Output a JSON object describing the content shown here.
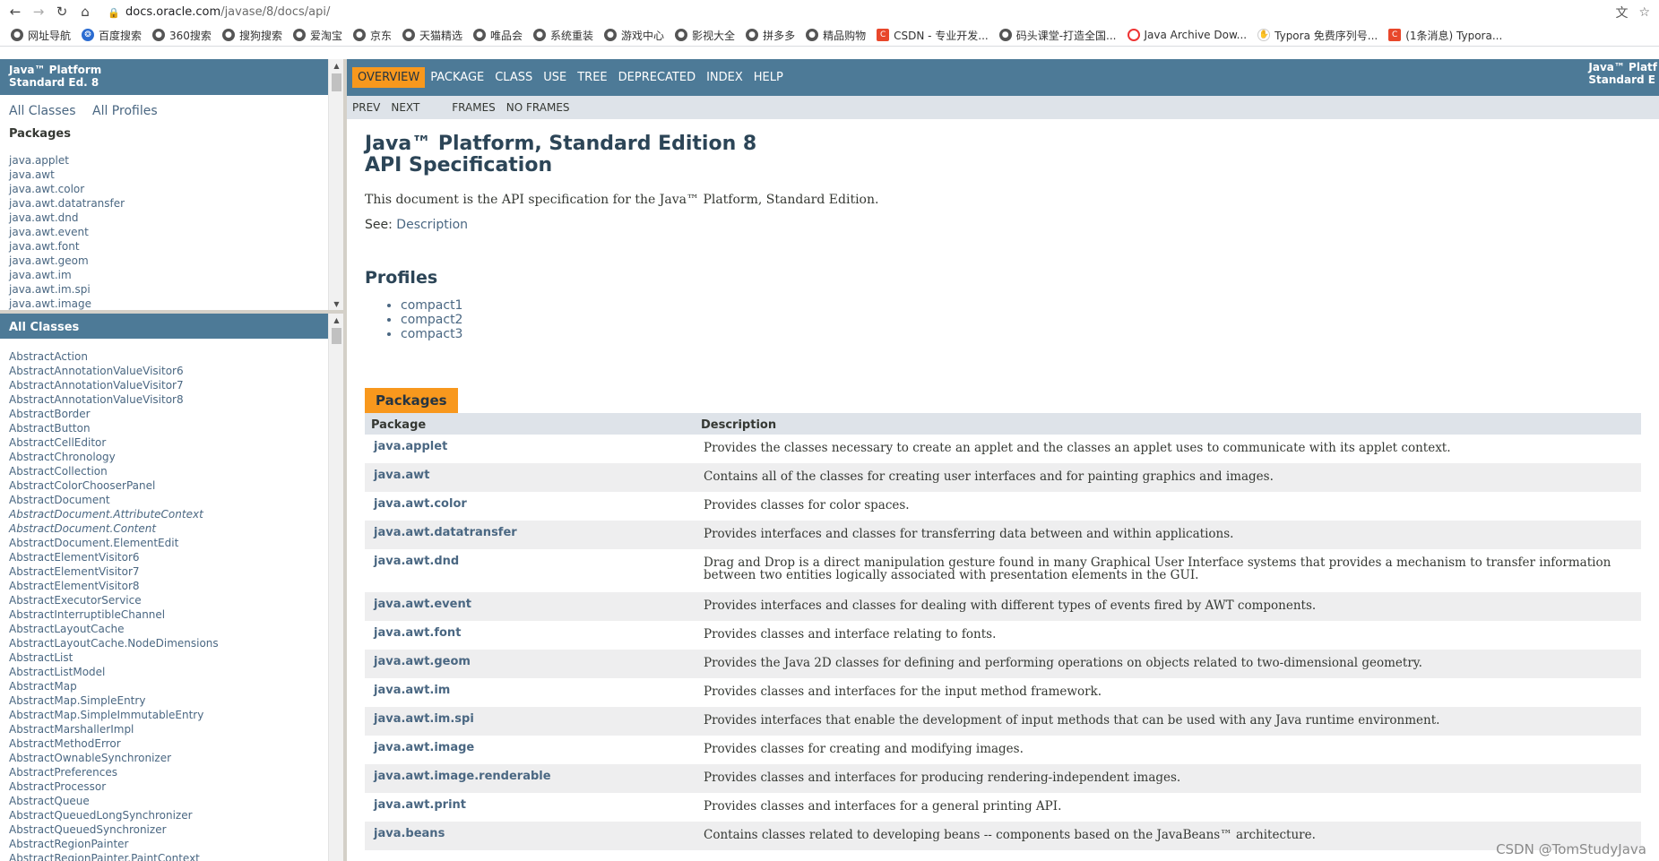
{
  "browser": {
    "url_host": "docs.oracle.com",
    "url_path": "/javase/8/docs/api/",
    "bookmarks": [
      {
        "label": "网址导航",
        "icon": "globe-icon"
      },
      {
        "label": "百度搜索",
        "icon": "baidu-icon"
      },
      {
        "label": "360搜索",
        "icon": "globe-icon"
      },
      {
        "label": "搜狗搜索",
        "icon": "globe-icon"
      },
      {
        "label": "爱淘宝",
        "icon": "globe-icon"
      },
      {
        "label": "京东",
        "icon": "globe-icon"
      },
      {
        "label": "天猫精选",
        "icon": "globe-icon"
      },
      {
        "label": "唯品会",
        "icon": "globe-icon"
      },
      {
        "label": "系统重装",
        "icon": "globe-icon"
      },
      {
        "label": "游戏中心",
        "icon": "globe-icon"
      },
      {
        "label": "影视大全",
        "icon": "globe-icon"
      },
      {
        "label": "拼多多",
        "icon": "globe-icon"
      },
      {
        "label": "精品购物",
        "icon": "globe-icon"
      },
      {
        "label": "CSDN - 专业开发...",
        "icon": "csdn-icon"
      },
      {
        "label": "码头课堂-打造全国...",
        "icon": "globe-icon"
      },
      {
        "label": "Java Archive Dow...",
        "icon": "oracle-icon"
      },
      {
        "label": "Typora 免费序列号...",
        "icon": "hand-icon"
      },
      {
        "label": "(1条消息) Typora...",
        "icon": "csdn-icon"
      }
    ]
  },
  "left_top": {
    "header_line1": "Java™ Platform",
    "header_line2": "Standard Ed. 8",
    "link_all_classes": "All Classes",
    "link_all_profiles": "All Profiles",
    "packages_heading": "Packages",
    "packages": [
      "java.applet",
      "java.awt",
      "java.awt.color",
      "java.awt.datatransfer",
      "java.awt.dnd",
      "java.awt.event",
      "java.awt.font",
      "java.awt.geom",
      "java.awt.im",
      "java.awt.im.spi",
      "java.awt.image"
    ]
  },
  "left_bottom": {
    "header": "All Classes",
    "classes": [
      {
        "name": "AbstractAction",
        "italic": false
      },
      {
        "name": "AbstractAnnotationValueVisitor6",
        "italic": false
      },
      {
        "name": "AbstractAnnotationValueVisitor7",
        "italic": false
      },
      {
        "name": "AbstractAnnotationValueVisitor8",
        "italic": false
      },
      {
        "name": "AbstractBorder",
        "italic": false
      },
      {
        "name": "AbstractButton",
        "italic": false
      },
      {
        "name": "AbstractCellEditor",
        "italic": false
      },
      {
        "name": "AbstractChronology",
        "italic": false
      },
      {
        "name": "AbstractCollection",
        "italic": false
      },
      {
        "name": "AbstractColorChooserPanel",
        "italic": false
      },
      {
        "name": "AbstractDocument",
        "italic": false
      },
      {
        "name": "AbstractDocument.AttributeContext",
        "italic": true
      },
      {
        "name": "AbstractDocument.Content",
        "italic": true
      },
      {
        "name": "AbstractDocument.ElementEdit",
        "italic": false
      },
      {
        "name": "AbstractElementVisitor6",
        "italic": false
      },
      {
        "name": "AbstractElementVisitor7",
        "italic": false
      },
      {
        "name": "AbstractElementVisitor8",
        "italic": false
      },
      {
        "name": "AbstractExecutorService",
        "italic": false
      },
      {
        "name": "AbstractInterruptibleChannel",
        "italic": false
      },
      {
        "name": "AbstractLayoutCache",
        "italic": false
      },
      {
        "name": "AbstractLayoutCache.NodeDimensions",
        "italic": false
      },
      {
        "name": "AbstractList",
        "italic": false
      },
      {
        "name": "AbstractListModel",
        "italic": false
      },
      {
        "name": "AbstractMap",
        "italic": false
      },
      {
        "name": "AbstractMap.SimpleEntry",
        "italic": false
      },
      {
        "name": "AbstractMap.SimpleImmutableEntry",
        "italic": false
      },
      {
        "name": "AbstractMarshallerImpl",
        "italic": false
      },
      {
        "name": "AbstractMethodError",
        "italic": false
      },
      {
        "name": "AbstractOwnableSynchronizer",
        "italic": false
      },
      {
        "name": "AbstractPreferences",
        "italic": false
      },
      {
        "name": "AbstractProcessor",
        "italic": false
      },
      {
        "name": "AbstractQueue",
        "italic": false
      },
      {
        "name": "AbstractQueuedLongSynchronizer",
        "italic": false
      },
      {
        "name": "AbstractQueuedSynchronizer",
        "italic": false
      },
      {
        "name": "AbstractRegionPainter",
        "italic": false
      },
      {
        "name": "AbstractRegionPainter.PaintContext",
        "italic": false
      }
    ]
  },
  "main": {
    "top_nav": [
      "OVERVIEW",
      "PACKAGE",
      "CLASS",
      "USE",
      "TREE",
      "DEPRECATED",
      "INDEX",
      "HELP"
    ],
    "brand_line1": "Java™ Platf",
    "brand_line2": "Standard E",
    "sub_nav": {
      "prev": "PREV",
      "next": "NEXT",
      "frames": "FRAMES",
      "no_frames": "NO FRAMES"
    },
    "title_line1": "Java™ Platform, Standard Edition 8",
    "title_line2": "API Specification",
    "lead": "This document is the API specification for the Java™ Platform, Standard Edition.",
    "see_label": "See:",
    "see_link": "Description",
    "profiles_heading": "Profiles",
    "profiles": [
      "compact1",
      "compact2",
      "compact3"
    ],
    "packages_caption": "Packages",
    "col_package": "Package",
    "col_description": "Description",
    "packages": [
      {
        "name": "java.applet",
        "desc": "Provides the classes necessary to create an applet and the classes an applet uses to communicate with its applet context."
      },
      {
        "name": "java.awt",
        "desc": "Contains all of the classes for creating user interfaces and for painting graphics and images."
      },
      {
        "name": "java.awt.color",
        "desc": "Provides classes for color spaces."
      },
      {
        "name": "java.awt.datatransfer",
        "desc": "Provides interfaces and classes for transferring data between and within applications."
      },
      {
        "name": "java.awt.dnd",
        "desc": "Drag and Drop is a direct manipulation gesture found in many Graphical User Interface systems that provides a mechanism to transfer information between two entities logically associated with presentation elements in the GUI."
      },
      {
        "name": "java.awt.event",
        "desc": "Provides interfaces and classes for dealing with different types of events fired by AWT components."
      },
      {
        "name": "java.awt.font",
        "desc": "Provides classes and interface relating to fonts."
      },
      {
        "name": "java.awt.geom",
        "desc": "Provides the Java 2D classes for defining and performing operations on objects related to two-dimensional geometry."
      },
      {
        "name": "java.awt.im",
        "desc": "Provides classes and interfaces for the input method framework."
      },
      {
        "name": "java.awt.im.spi",
        "desc": "Provides interfaces that enable the development of input methods that can be used with any Java runtime environment."
      },
      {
        "name": "java.awt.image",
        "desc": "Provides classes for creating and modifying images."
      },
      {
        "name": "java.awt.image.renderable",
        "desc": "Provides classes and interfaces for producing rendering-independent images."
      },
      {
        "name": "java.awt.print",
        "desc": "Provides classes and interfaces for a general printing API."
      },
      {
        "name": "java.beans",
        "desc": "Contains classes related to developing beans -- components based on the JavaBeans™ architecture."
      }
    ]
  },
  "watermark": "CSDN @TomStudyJava"
}
